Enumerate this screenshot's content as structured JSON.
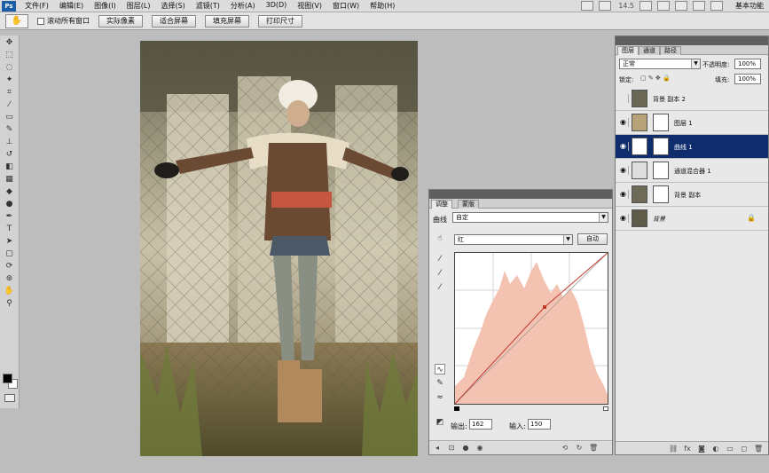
{
  "menu": {
    "logo": "Ps",
    "items": [
      "文件(F)",
      "编辑(E)",
      "图像(I)",
      "图层(L)",
      "选择(S)",
      "滤镜(T)",
      "分析(A)",
      "3D(D)",
      "视图(V)",
      "窗口(W)",
      "帮助(H)"
    ],
    "zoom": "14.5",
    "workspace": "基本功能"
  },
  "options": {
    "scroll_all_label": "滚动所有窗口",
    "btn_actual": "实际像素",
    "btn_fit": "适合屏幕",
    "btn_fill": "填充屏幕",
    "btn_print": "打印尺寸"
  },
  "adjustments": {
    "tabs": [
      "调整",
      "蒙版"
    ],
    "type_label": "曲线",
    "preset": "自定",
    "channel": "红",
    "auto_label": "自动",
    "output_label": "输出:",
    "output_value": "162",
    "input_label": "输入:",
    "input_value": "150",
    "curve_color": "#c0392b",
    "histogram_color": "#f3c2b1"
  },
  "layers": {
    "tabs": [
      "图层",
      "通道",
      "路径"
    ],
    "blend_mode": "正常",
    "opacity_label": "不透明度:",
    "opacity": "100%",
    "lock_label": "锁定:",
    "fill_label": "填充:",
    "fill": "100%",
    "items": [
      {
        "name": "背景 副本 2",
        "visible": false
      },
      {
        "name": "图层 1",
        "visible": true
      },
      {
        "name": "曲线 1",
        "visible": true,
        "selected": true
      },
      {
        "name": "通道混合器 1",
        "visible": true
      },
      {
        "name": "背景 副本",
        "visible": true
      },
      {
        "name": "背景",
        "visible": true
      }
    ],
    "selection_color": "#0f2d6c"
  }
}
